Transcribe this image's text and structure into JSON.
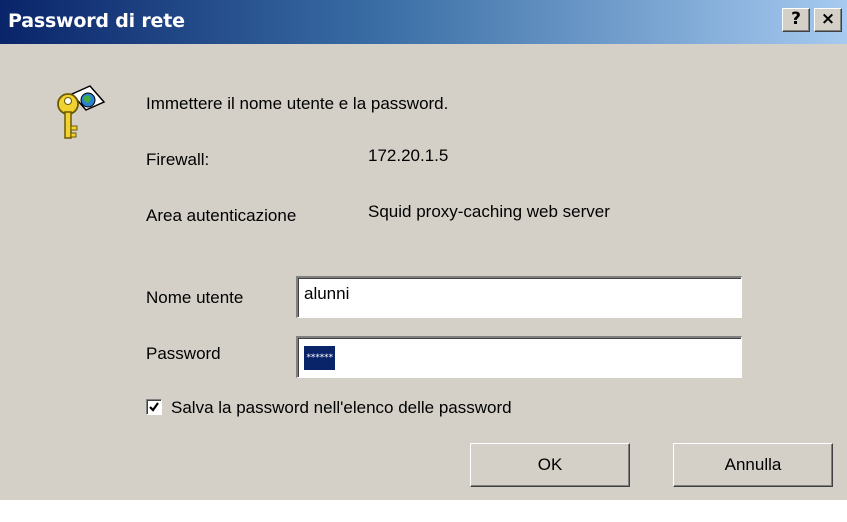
{
  "window": {
    "title": "Password di rete",
    "help_label": "?",
    "close_label": "×"
  },
  "icon": "key-globe-icon",
  "prompt": "Immettere il nome utente e la password.",
  "firewall": {
    "label": "Firewall:",
    "value": "172.20.1.5"
  },
  "realm": {
    "label": "Area autenticazione",
    "value": "Squid proxy-caching web server"
  },
  "username": {
    "label": "Nome utente",
    "value": "alunni"
  },
  "password": {
    "label": "Password",
    "masked": "******"
  },
  "save_password": {
    "label": "Salva la password nell'elenco delle password",
    "checked": true,
    "mark": "✔"
  },
  "buttons": {
    "ok": "OK",
    "cancel": "Annulla"
  },
  "colors": {
    "title_start": "#0a246a",
    "title_end": "#a6caf0",
    "face": "#d4d0c8",
    "selection": "#0a246a"
  }
}
